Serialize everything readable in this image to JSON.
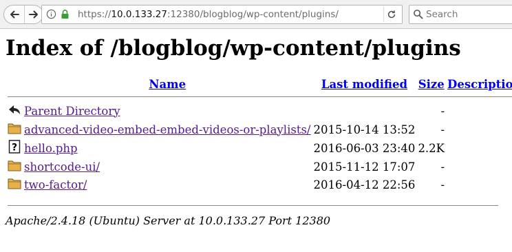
{
  "browser": {
    "url_prefix": "https://",
    "url_host": "10.0.133.27",
    "url_rest": ":12380/blogblog/wp-content/plugins/",
    "search_placeholder": "Search"
  },
  "page": {
    "title": "Index of /blogblog/wp-content/plugins",
    "columns": {
      "name": "Name",
      "last_modified": "Last modified",
      "size": "Size",
      "description": "Description"
    },
    "rows": [
      {
        "icon": "back-icon",
        "name": "Parent Directory",
        "date": "",
        "size": "-",
        "desc": ""
      },
      {
        "icon": "folder-icon",
        "name": "advanced-video-embed-embed-videos-or-playlists/",
        "date": "2015-10-14 13:52",
        "size": "-",
        "desc": ""
      },
      {
        "icon": "file-unknown-icon",
        "name": "hello.php",
        "date": "2016-06-03 23:40",
        "size": "2.2K",
        "desc": ""
      },
      {
        "icon": "folder-icon",
        "name": "shortcode-ui/",
        "date": "2015-11-12 17:07",
        "size": "-",
        "desc": ""
      },
      {
        "icon": "folder-icon",
        "name": "two-factor/",
        "date": "2016-04-12 22:56",
        "size": "-",
        "desc": ""
      }
    ],
    "footer": "Apache/2.4.18 (Ubuntu) Server at 10.0.133.27 Port 12380"
  },
  "colors": {
    "visited_link": "#551a8b",
    "header_link": "#0000ee",
    "folder": "#e8b04a"
  }
}
